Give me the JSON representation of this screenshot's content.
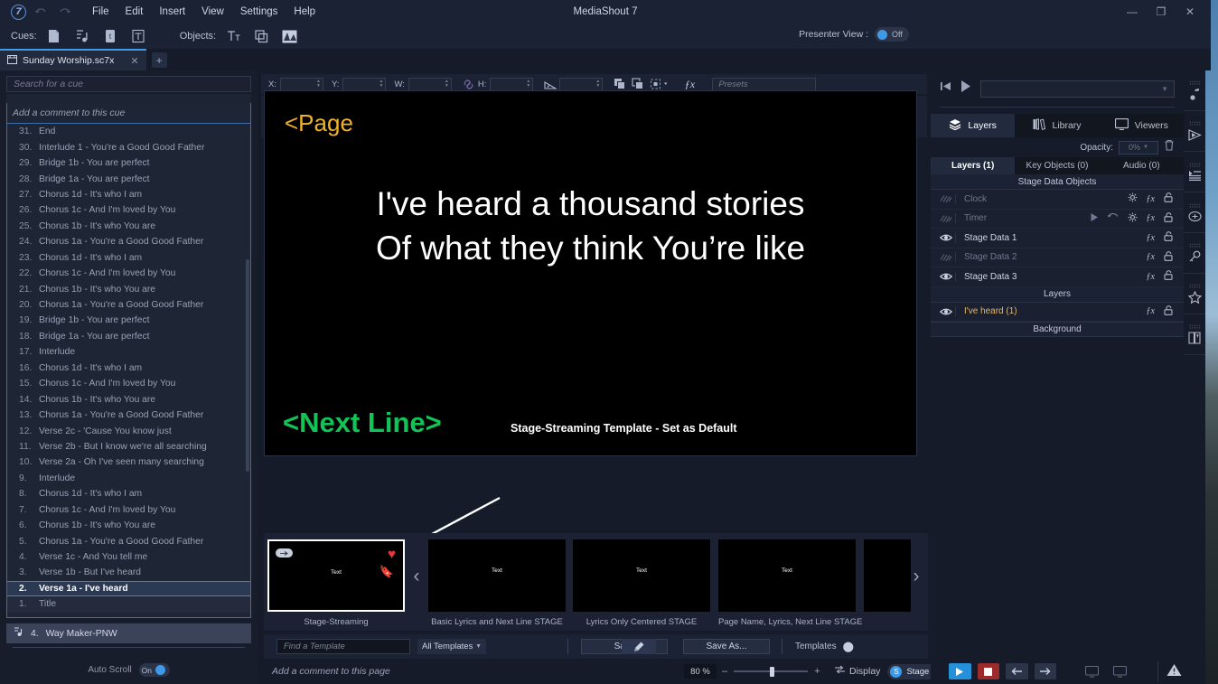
{
  "window": {
    "title": "MediaShout 7",
    "logo": "7",
    "minimize": "—",
    "maximize": "❐",
    "close": "✕"
  },
  "menu": {
    "undo_icon": "undo-icon",
    "redo_icon": "redo-icon",
    "items": [
      "File",
      "Edit",
      "Insert",
      "View",
      "Settings",
      "Help"
    ]
  },
  "cuebar": {
    "cues_label": "Cues:",
    "cue_icons": [
      "document-cue-icon",
      "audio-cue-icon",
      "text-cue-icon",
      "title-cue-icon"
    ],
    "objects_label": "Objects:",
    "object_icons": [
      "text-object-icon",
      "shape-object-icon",
      "media-object-icon"
    ],
    "presenter_view_label": "Presenter View :",
    "presenter_view_state": "Off"
  },
  "tabs": {
    "document": "Sunday Worship.sc7x",
    "close": "✕",
    "add": "+"
  },
  "cue_panel": {
    "search_placeholder": "Search for a cue",
    "comment_placeholder": "Add a comment to this cue",
    "items": [
      {
        "num": "1.",
        "label": "Title"
      },
      {
        "num": "2.",
        "label": "Verse 1a - I've heard"
      },
      {
        "num": "3.",
        "label": "Verse 1b - But I've heard"
      },
      {
        "num": "4.",
        "label": "Verse 1c - And You tell me"
      },
      {
        "num": "5.",
        "label": "Chorus 1a - You're a Good Good Father"
      },
      {
        "num": "6.",
        "label": "Chorus 1b - It's who You are"
      },
      {
        "num": "7.",
        "label": "Chorus 1c - And I'm loved by You"
      },
      {
        "num": "8.",
        "label": "Chorus 1d - It's who I am"
      },
      {
        "num": "9.",
        "label": "Interlude"
      },
      {
        "num": "10.",
        "label": "Verse 2a - Oh I've seen many searching"
      },
      {
        "num": "11.",
        "label": "Verse 2b - But I know we're all searching"
      },
      {
        "num": "12.",
        "label": "Verse 2c - 'Cause You know just"
      },
      {
        "num": "13.",
        "label": "Chorus 1a - You're a Good Good Father"
      },
      {
        "num": "14.",
        "label": "Chorus 1b - It's who You are"
      },
      {
        "num": "15.",
        "label": "Chorus 1c - And I'm loved by You"
      },
      {
        "num": "16.",
        "label": "Chorus 1d - It's who I am"
      },
      {
        "num": "17.",
        "label": "Interlude"
      },
      {
        "num": "18.",
        "label": "Bridge 1a - You are perfect"
      },
      {
        "num": "19.",
        "label": "Bridge 1b - You are perfect"
      },
      {
        "num": "20.",
        "label": "Chorus 1a - You're a Good Good Father"
      },
      {
        "num": "21.",
        "label": "Chorus 1b - It's who You are"
      },
      {
        "num": "22.",
        "label": "Chorus 1c - And I'm loved by You"
      },
      {
        "num": "23.",
        "label": "Chorus 1d - It's who I am"
      },
      {
        "num": "24.",
        "label": "Chorus 1a - You're a Good Good Father"
      },
      {
        "num": "25.",
        "label": "Chorus 1b - It's who You are"
      },
      {
        "num": "26.",
        "label": "Chorus 1c - And I'm loved by You"
      },
      {
        "num": "27.",
        "label": "Chorus 1d - It's who I am"
      },
      {
        "num": "28.",
        "label": "Bridge 1a - You are perfect"
      },
      {
        "num": "29.",
        "label": "Bridge 1b - You are perfect"
      },
      {
        "num": "30.",
        "label": "Interlude 1 - You're a Good Good Father"
      },
      {
        "num": "31.",
        "label": "End"
      }
    ],
    "selected_index": 1,
    "audio_cue": {
      "num": "4.",
      "label": "Way Maker-PNW",
      "icon": "audio-note-icon"
    },
    "autoscroll_label": "Auto Scroll",
    "autoscroll_state": "On"
  },
  "properties": {
    "x_label": "X:",
    "x_value": "",
    "y_label": "Y:",
    "y_value": "",
    "w_label": "W:",
    "w_value": "",
    "h_label": "H:",
    "h_value": "",
    "rotation_value": "",
    "link_icon": "link-icon",
    "angle_icon": "rotate-icon",
    "bring_forward_icon": "bring-forward-icon",
    "send_backward_icon": "send-backward-icon",
    "align_icon": "align-icon",
    "fx_label": "ƒx",
    "presets_placeholder": "Presets"
  },
  "slide": {
    "page_token": "<Page",
    "lyric_line1": "I've heard a thousand stories",
    "lyric_line2": "Of what they think You’re like",
    "next_line_token": "<Next Line>",
    "annotation": "Stage-Streaming Template - Set as Default",
    "page_color": "#f0b323",
    "next_line_color": "#12c457"
  },
  "templates": {
    "prev_arrow": "‹",
    "next_arrow": "›",
    "items": [
      {
        "caption": "Stage-Streaming",
        "thumb_text": "Text",
        "active": true,
        "badges": [
          "pill-icon",
          "heart-icon",
          "bookmark-icon"
        ]
      },
      {
        "caption": "Basic Lyrics and Next Line STAGE",
        "thumb_text": "Text",
        "active": false,
        "badges": []
      },
      {
        "caption": "Lyrics Only Centered STAGE",
        "thumb_text": "Text",
        "active": false,
        "badges": []
      },
      {
        "caption": "Page Name, Lyrics, Next Line STAGE",
        "thumb_text": "Text",
        "active": false,
        "badges": []
      },
      {
        "caption": "",
        "thumb_text": "",
        "active": false,
        "badges": []
      }
    ],
    "find_placeholder": "Find a Template",
    "filter_value": "All Templates",
    "brush_icon": "brush-icon",
    "save_label": "Save",
    "save_as_label": "Save As...",
    "templates_menu_label": "Templates",
    "templates_menu_icon": "chevron-down-icon"
  },
  "status": {
    "page_comment_placeholder": "Add a comment to this page",
    "zoom_value": "80 %",
    "zoom_minus": "–",
    "zoom_plus": "+",
    "fit_icon": "fit-screen-icon",
    "display_label": "Display",
    "display_value": "Stage",
    "display_badge": "S"
  },
  "right_panel": {
    "transport": {
      "prev_icon": "skip-back-icon",
      "play_icon": "play-icon",
      "dropdown_value": ""
    },
    "main_tabs": [
      {
        "label": "Layers",
        "icon": "layers-icon",
        "active": true
      },
      {
        "label": "Library",
        "icon": "library-icon",
        "active": false
      },
      {
        "label": "Viewers",
        "icon": "monitor-icon",
        "active": false
      }
    ],
    "opacity_label": "Opacity:",
    "opacity_value": "0%",
    "delete_icon": "trash-icon",
    "sub_tabs": [
      {
        "label": "Layers (1)",
        "active": true
      },
      {
        "label": "Key Objects (0)",
        "active": false
      },
      {
        "label": "Audio (0)",
        "active": false
      }
    ],
    "groups": [
      {
        "header": "Stage Data Objects",
        "rows": [
          {
            "name": "Clock",
            "visible": false,
            "dim": true,
            "highlight": false,
            "actions": [
              "gear-icon",
              "fx-icon",
              "lock-icon"
            ]
          },
          {
            "name": "Timer",
            "visible": false,
            "dim": true,
            "highlight": false,
            "actions": [
              "play-icon",
              "reset-icon",
              "gear-icon",
              "fx-icon",
              "lock-icon"
            ]
          },
          {
            "name": "Stage Data 1",
            "visible": true,
            "dim": false,
            "highlight": false,
            "actions": [
              "fx-icon",
              "lock-icon"
            ]
          },
          {
            "name": "Stage Data 2",
            "visible": false,
            "dim": true,
            "highlight": false,
            "actions": [
              "fx-icon",
              "lock-icon"
            ]
          },
          {
            "name": "Stage Data 3",
            "visible": true,
            "dim": false,
            "highlight": false,
            "actions": [
              "fx-icon",
              "lock-icon"
            ]
          }
        ]
      },
      {
        "header": "Layers",
        "rows": [
          {
            "name": "I've heard (1)",
            "visible": true,
            "dim": false,
            "highlight": true,
            "actions": [
              "fx-icon",
              "lock-icon"
            ]
          }
        ]
      }
    ],
    "background_header": "Background"
  },
  "rail": {
    "items": [
      "music-note-icon",
      "video-play-icon",
      "playlist-icon",
      "link-circle-icon",
      "key-icon",
      "star-icon",
      "bible-book-icon"
    ]
  },
  "playback": {
    "play_icon": "play-icon",
    "stop_icon": "stop-icon",
    "prev_icon": "arrow-left-icon",
    "next_icon": "arrow-right-icon",
    "monitor1_icon": "monitor-main-icon",
    "monitor2_icon": "monitor-stage-icon",
    "warning_icon": "warning-icon"
  }
}
